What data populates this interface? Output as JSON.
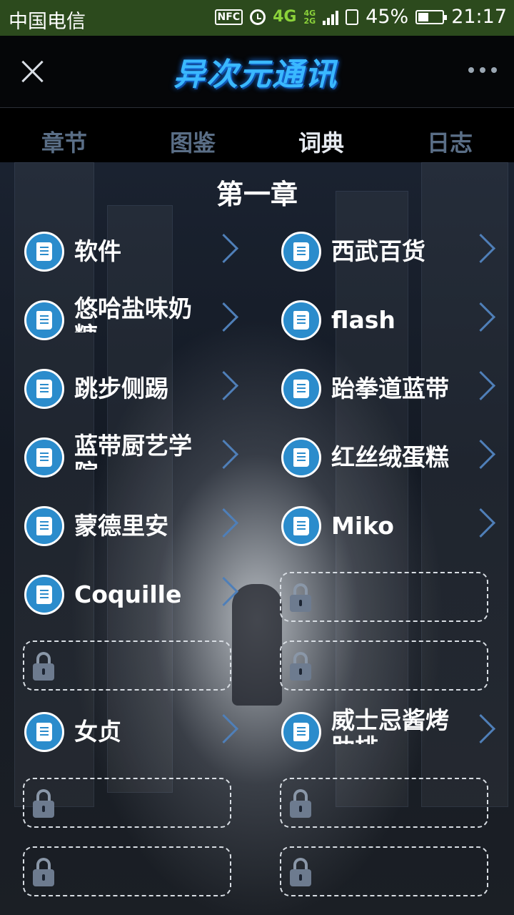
{
  "status_bar": {
    "carrier": "中国电信",
    "nfc": "NFC",
    "network": "4G",
    "network_mini": [
      "4G",
      "2G"
    ],
    "battery": "45%",
    "battery_level": 0.45,
    "time": "21:17"
  },
  "header": {
    "logo_text": "异次元通讯"
  },
  "tabs": [
    {
      "label": "章节",
      "active": false
    },
    {
      "label": "图鉴",
      "active": false
    },
    {
      "label": "词典",
      "active": true
    },
    {
      "label": "日志",
      "active": false
    }
  ],
  "chapter": {
    "title": "第一章"
  },
  "entries": {
    "left": [
      {
        "label": "软件",
        "locked": false
      },
      {
        "label": "悠哈盐味奶糖",
        "locked": false
      },
      {
        "label": "跳步侧踢",
        "locked": false
      },
      {
        "label": "蓝带厨艺学院",
        "locked": false
      },
      {
        "label": "蒙德里安",
        "locked": false
      },
      {
        "label": "Coquille",
        "locked": false
      },
      {
        "label": "",
        "locked": true
      },
      {
        "label": "女贞",
        "locked": false
      },
      {
        "label": "",
        "locked": true
      },
      {
        "label": "",
        "locked": true
      }
    ],
    "right": [
      {
        "label": "西武百货",
        "locked": false
      },
      {
        "label": "flash",
        "locked": false
      },
      {
        "label": "跆拳道蓝带",
        "locked": false
      },
      {
        "label": "红丝绒蛋糕",
        "locked": false
      },
      {
        "label": "Miko",
        "locked": false
      },
      {
        "label": "",
        "locked": true
      },
      {
        "label": "",
        "locked": true
      },
      {
        "label": "威士忌酱烤肋排",
        "locked": false
      },
      {
        "label": "",
        "locked": true
      },
      {
        "label": "",
        "locked": true
      }
    ]
  },
  "colors": {
    "status_bar_bg": "#2c4a1d",
    "accent_blue": "#2b8ccc",
    "tab_inactive": "#5a6e86",
    "tab_active": "#e6eaf0"
  }
}
